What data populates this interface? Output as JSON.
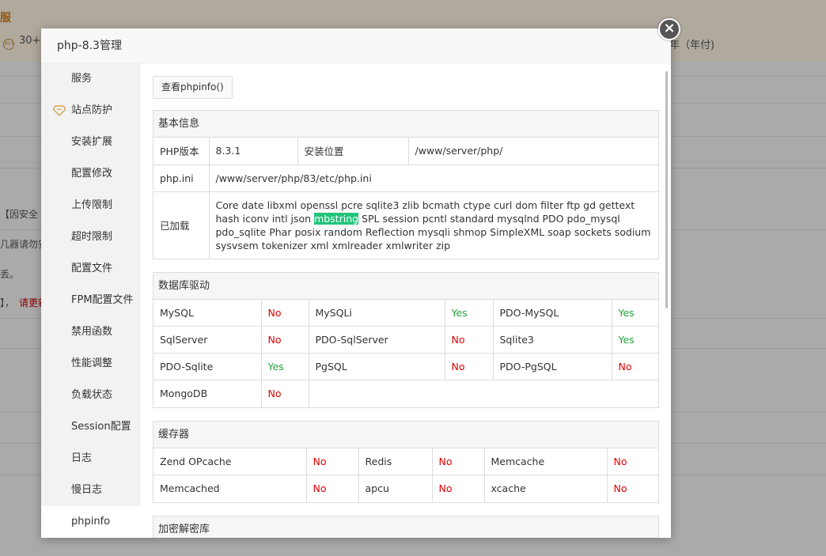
{
  "background": {
    "banner_title": "服",
    "banner_left_text": "30+",
    "banner_right_text": "年（年付)",
    "text_1": "【因安全",
    "text_2": "几器请勿安",
    "text_3": "丢。",
    "text_4": "】，",
    "text_5": "请更新"
  },
  "modal": {
    "title": "php-8.3管理",
    "close_icon": "×"
  },
  "sidebar": {
    "items": [
      {
        "label": "服务"
      },
      {
        "label": "站点防护"
      },
      {
        "label": "安装扩展"
      },
      {
        "label": "配置修改"
      },
      {
        "label": "上传限制"
      },
      {
        "label": "超时限制"
      },
      {
        "label": "配置文件"
      },
      {
        "label": "FPM配置文件"
      },
      {
        "label": "禁用函数"
      },
      {
        "label": "性能调整"
      },
      {
        "label": "负载状态"
      },
      {
        "label": "Session配置"
      },
      {
        "label": "日志"
      },
      {
        "label": "慢日志"
      },
      {
        "label": "phpinfo"
      }
    ],
    "active": "phpinfo"
  },
  "content": {
    "view_phpinfo_button": "查看phpinfo()",
    "basic": {
      "title": "基本信息",
      "php_version_label": "PHP版本",
      "php_version_value": "8.3.1",
      "install_path_label": "安装位置",
      "install_path_value": "/www/server/php/",
      "phpini_label": "php.ini",
      "phpini_value": "/www/server/php/83/etc/php.ini",
      "loaded_label": "已加载",
      "loaded_before": "Core date libxml openssl pcre sqlite3 zlib bcmath ctype curl dom filter ftp gd gettext hash iconv intl json ",
      "loaded_highlight": "mbstring",
      "loaded_after": " SPL session pcntl standard mysqlnd PDO pdo_mysql pdo_sqlite Phar posix random Reflection mysqli shmop SimpleXML soap sockets sodium sysvsem tokenizer xml xmlreader xmlwriter zip"
    },
    "db": {
      "title": "数据库驱动",
      "rows": [
        [
          {
            "name": "MySQL",
            "status": "No"
          },
          {
            "name": "MySQLi",
            "status": "Yes"
          },
          {
            "name": "PDO-MySQL",
            "status": "Yes"
          }
        ],
        [
          {
            "name": "SqlServer",
            "status": "No"
          },
          {
            "name": "PDO-SqlServer",
            "status": "No"
          },
          {
            "name": "Sqlite3",
            "status": "Yes"
          }
        ],
        [
          {
            "name": "PDO-Sqlite",
            "status": "Yes"
          },
          {
            "name": "PgSQL",
            "status": "No"
          },
          {
            "name": "PDO-PgSQL",
            "status": "No"
          }
        ],
        [
          {
            "name": "MongoDB",
            "status": "No"
          }
        ]
      ]
    },
    "cache": {
      "title": "缓存器",
      "rows": [
        [
          {
            "name": "Zend OPcache",
            "status": "No"
          },
          {
            "name": "Redis",
            "status": "No"
          },
          {
            "name": "Memcache",
            "status": "No"
          }
        ],
        [
          {
            "name": "Memcached",
            "status": "No"
          },
          {
            "name": "apcu",
            "status": "No"
          },
          {
            "name": "xcache",
            "status": "No"
          }
        ]
      ]
    },
    "crypto": {
      "title": "加密解密库"
    }
  },
  "colors": {
    "yes": "#20a53a",
    "no": "#e00000",
    "highlight": "#20c47a"
  }
}
